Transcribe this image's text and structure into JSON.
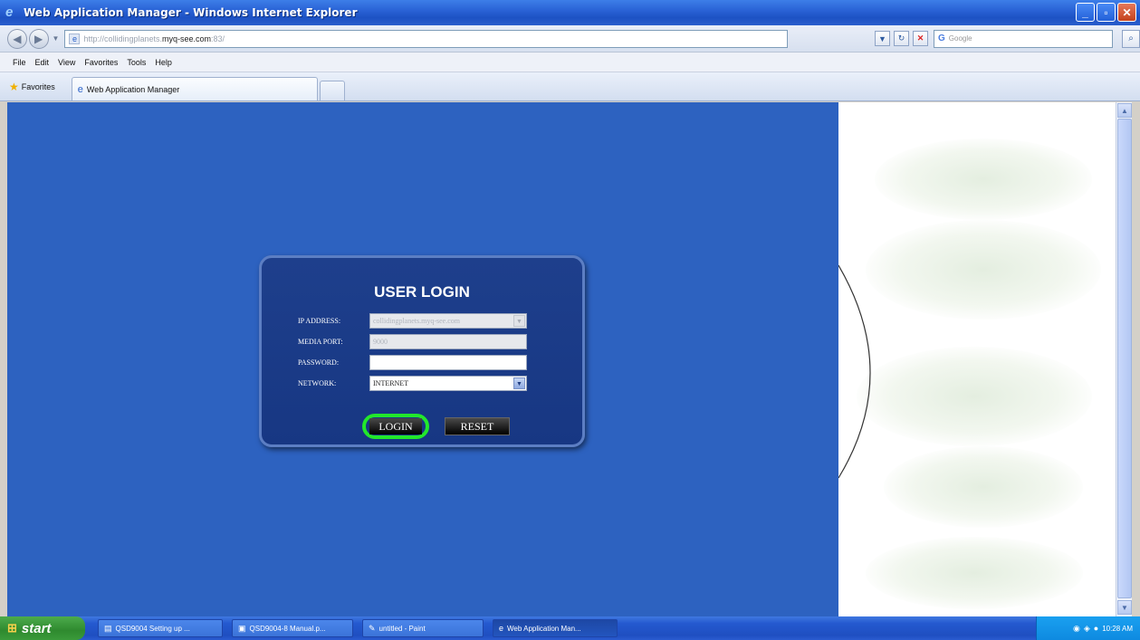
{
  "window": {
    "title": "Web Application Manager - Windows Internet Explorer",
    "minimize": "_",
    "maximize": "▫",
    "close": "✕"
  },
  "address_bar": {
    "url_prefix": "http://collidingplanets.",
    "url_host": "myq-see.com",
    "url_suffix": ":83/",
    "search_placeholder": "Google"
  },
  "menu": [
    "File",
    "Edit",
    "View",
    "Favorites",
    "Tools",
    "Help"
  ],
  "favorites_bar": {
    "favorites_label": "Favorites",
    "tab_title": "Web Application Manager"
  },
  "login": {
    "title": "USER LOGIN",
    "fields": [
      {
        "label": "IP ADDRESS:",
        "value": "collidingplanets.myq-see.com",
        "disabled": true,
        "select": true
      },
      {
        "label": "MEDIA PORT:",
        "value": "9000",
        "disabled": true,
        "select": false
      },
      {
        "label": "PASSWORD:",
        "value": "",
        "disabled": false,
        "select": false
      },
      {
        "label": "NETWORK:",
        "value": "INTERNET",
        "disabled": false,
        "select": true
      }
    ],
    "login_button": "LOGIN",
    "reset_button": "RESET"
  },
  "taskbar": {
    "start_label": "start",
    "items": [
      {
        "label": "QSD9004 Setting up ...",
        "icon": "document-icon"
      },
      {
        "label": "QSD9004-8 Manual.p...",
        "icon": "pdf-icon"
      },
      {
        "label": "untitled - Paint",
        "icon": "paint-icon"
      },
      {
        "label": "Web Application Man...",
        "icon": "ie-icon"
      }
    ],
    "clock": "10:28 AM"
  },
  "colors": {
    "page_blue": "#2d62c0",
    "login_panel": "#1e3f8c",
    "login_highlight": "#22e82b"
  }
}
